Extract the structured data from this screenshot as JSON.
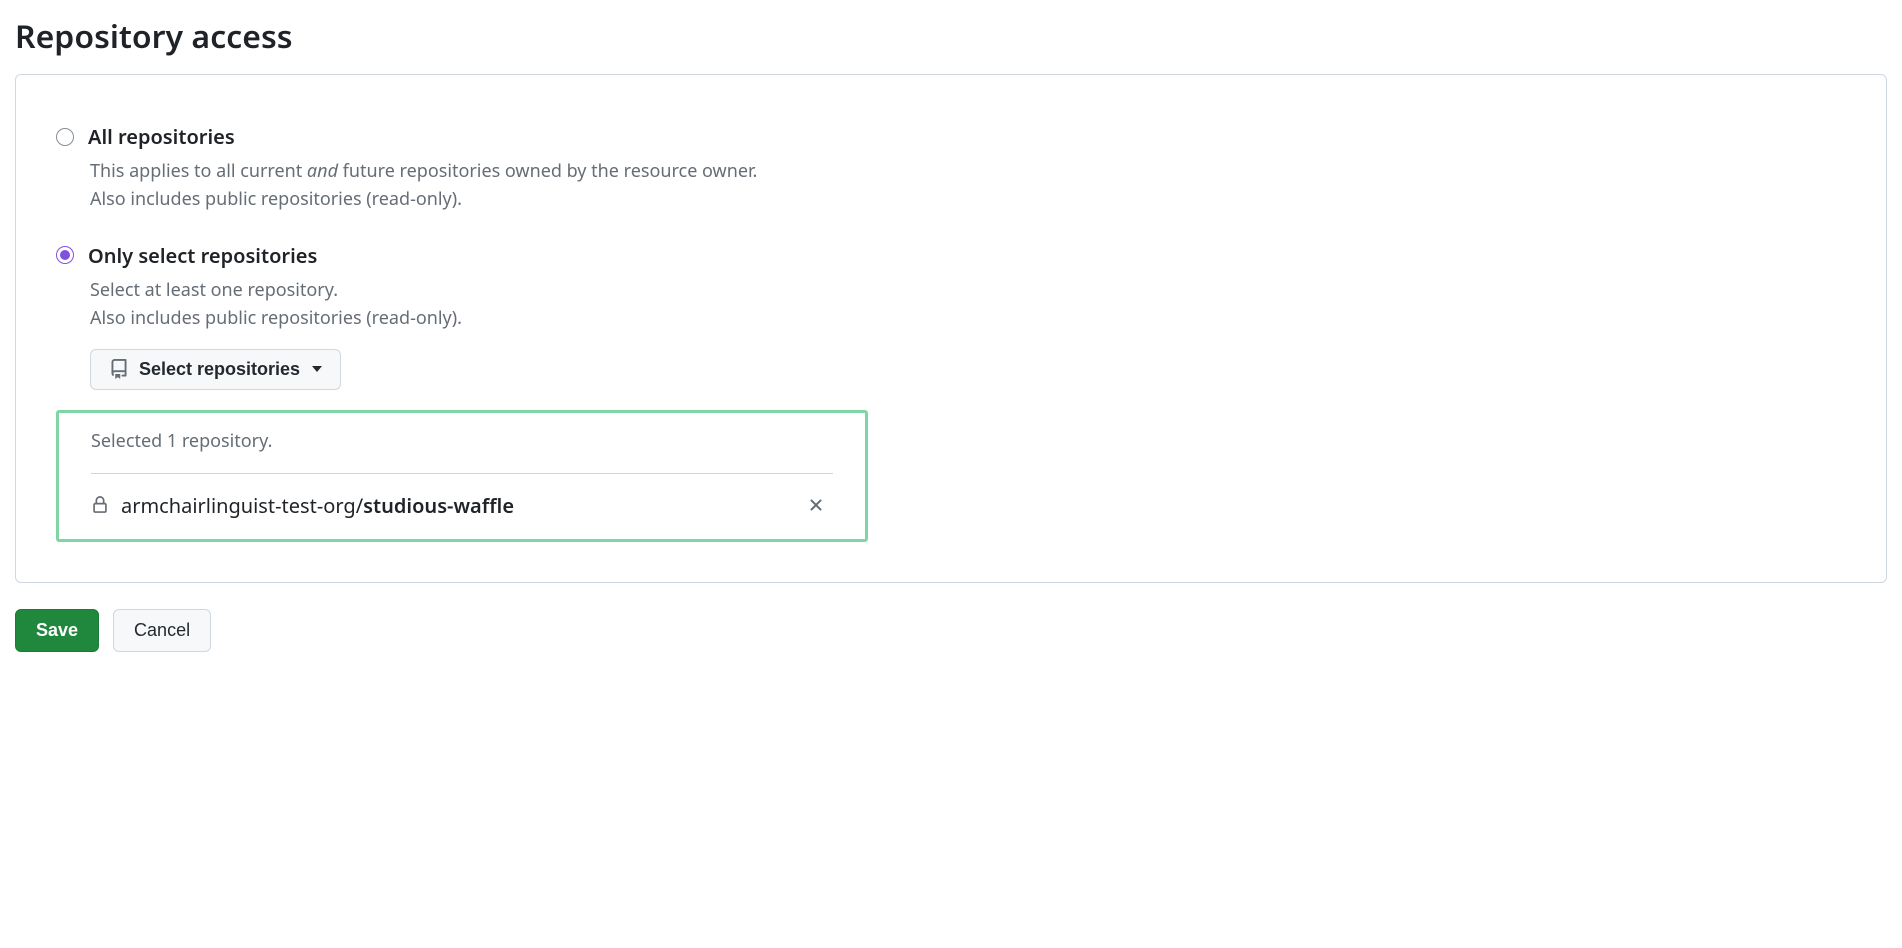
{
  "title": "Repository access",
  "options": {
    "all": {
      "label": "All repositories",
      "desc_line1_a": "This applies to all current ",
      "desc_line1_em": "and",
      "desc_line1_b": " future repositories owned by the resource owner.",
      "desc_line2": "Also includes public repositories (read-only)."
    },
    "select": {
      "label": "Only select repositories",
      "desc_line1": "Select at least one repository.",
      "desc_line2": "Also includes public repositories (read-only).",
      "button_label": "Select repositories"
    }
  },
  "selected": {
    "summary": "Selected 1 repository.",
    "repo_owner": "armchairlinguist-test-org/",
    "repo_name": "studious-waffle"
  },
  "actions": {
    "save": "Save",
    "cancel": "Cancel"
  }
}
